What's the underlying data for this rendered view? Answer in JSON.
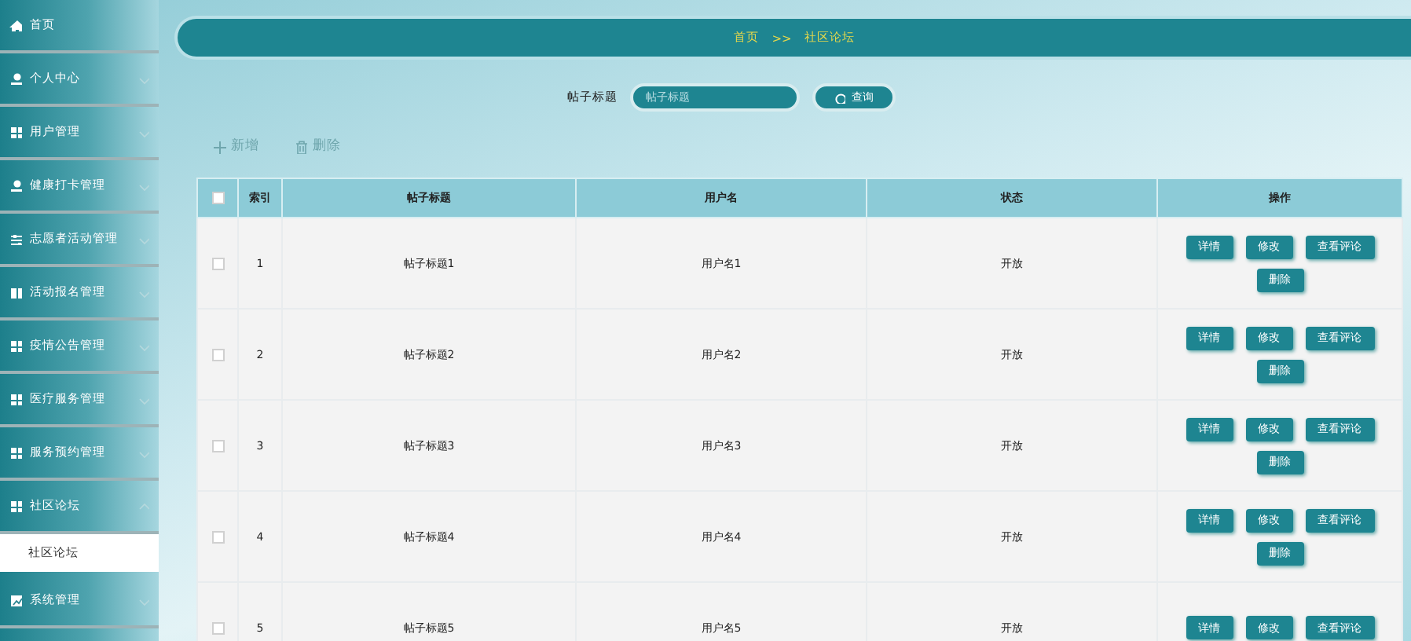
{
  "sidebar": {
    "items": [
      {
        "label": "首页",
        "has_arrow": false
      },
      {
        "label": "个人中心",
        "has_arrow": true,
        "expanded": false
      },
      {
        "label": "用户管理",
        "has_arrow": true,
        "expanded": false
      },
      {
        "label": "健康打卡管理",
        "has_arrow": true,
        "expanded": false
      },
      {
        "label": "志愿者活动管理",
        "has_arrow": true,
        "expanded": false
      },
      {
        "label": "活动报名管理",
        "has_arrow": true,
        "expanded": false
      },
      {
        "label": "疫情公告管理",
        "has_arrow": true,
        "expanded": false
      },
      {
        "label": "医疗服务管理",
        "has_arrow": true,
        "expanded": false
      },
      {
        "label": "服务预约管理",
        "has_arrow": true,
        "expanded": false
      },
      {
        "label": "社区论坛",
        "has_arrow": true,
        "expanded": true,
        "children": [
          {
            "label": "社区论坛",
            "selected": true
          }
        ]
      },
      {
        "label": "系统管理",
        "has_arrow": true,
        "expanded": false
      }
    ]
  },
  "breadcrumb": {
    "home": "首页",
    "separator": ">>",
    "current": "社区论坛"
  },
  "search": {
    "label": "帖子标题",
    "placeholder": "帖子标题",
    "button": "查询"
  },
  "toolbar": {
    "add": "新增",
    "delete": "删除"
  },
  "table": {
    "select_all_checked": false,
    "columns": [
      "索引",
      "帖子标题",
      "用户名",
      "状态",
      "操作"
    ],
    "rows": [
      {
        "checked": false,
        "index": "1",
        "title": "帖子标题1",
        "user": "用户名1",
        "status": "开放",
        "actions": [
          "详情",
          "修改",
          "查看评论",
          "删除"
        ]
      },
      {
        "checked": false,
        "index": "2",
        "title": "帖子标题2",
        "user": "用户名2",
        "status": "开放",
        "actions": [
          "详情",
          "修改",
          "查看评论",
          "删除"
        ]
      },
      {
        "checked": false,
        "index": "3",
        "title": "帖子标题3",
        "user": "用户名3",
        "status": "开放",
        "actions": [
          "详情",
          "修改",
          "查看评论",
          "删除"
        ]
      },
      {
        "checked": false,
        "index": "4",
        "title": "帖子标题4",
        "user": "用户名4",
        "status": "开放",
        "actions": [
          "详情",
          "修改",
          "查看评论",
          "删除"
        ]
      },
      {
        "checked": false,
        "index": "5",
        "title": "帖子标题5",
        "user": "用户名5",
        "status": "开放",
        "actions": [
          "详情",
          "修改",
          "查看评论"
        ]
      }
    ]
  }
}
